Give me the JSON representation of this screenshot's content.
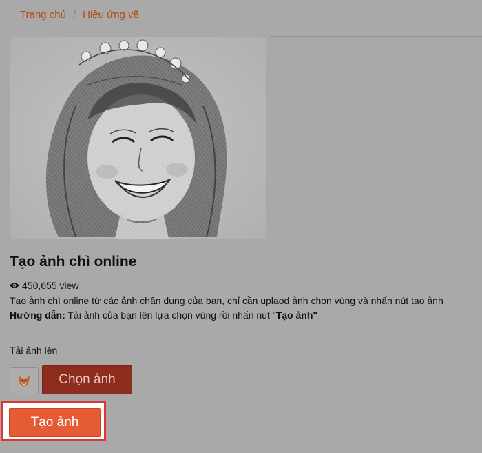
{
  "breadcrumb": {
    "home": "Trang chủ",
    "separator": "/",
    "current": "Hiệu ứng vẽ"
  },
  "effect": {
    "title": "Tạo ảnh chì online",
    "views": "450,655 view",
    "description": "Tạo ảnh chì online từ các ảnh chân dung của bạn, chỉ cần uplaod ảnh chọn vùng và nhấn nút tạo ảnh",
    "guide_label": "Hướng dẫn:",
    "guide_text": " Tải ảnh của bạn lên lựa chọn vùng rồi nhấn nút \"",
    "guide_button_name": "Tạo ảnh",
    "guide_end": "\""
  },
  "upload": {
    "label": "Tải ảnh lên",
    "choose_label": "Chọn ảnh",
    "create_label": "Tạo ảnh"
  },
  "icons": {
    "views": "eye-icon",
    "thumbnail": "fox-icon"
  },
  "colors": {
    "link": "#b34a10",
    "choose_button": "#8e2d1e",
    "create_button": "#e55b34",
    "highlight": "#e03434"
  }
}
